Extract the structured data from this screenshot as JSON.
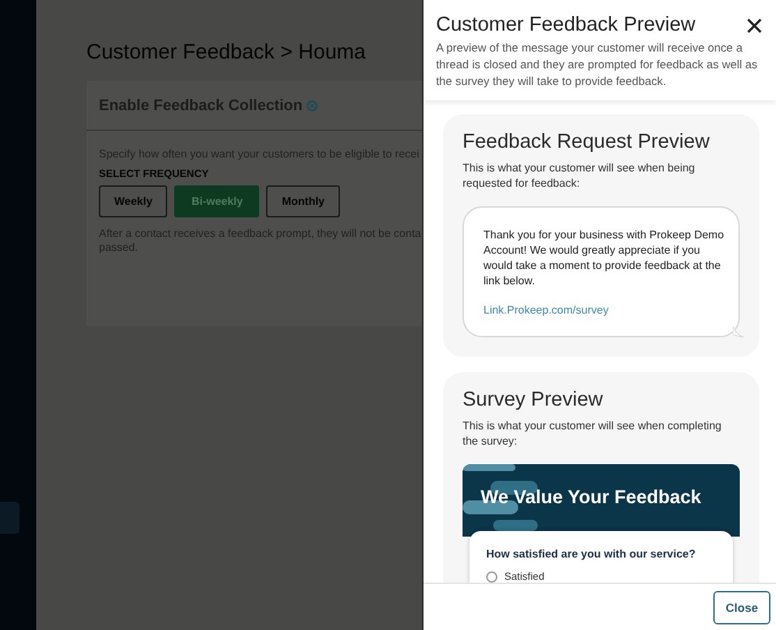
{
  "background": {
    "title": "Customer Feedback > Houma",
    "card": {
      "title": "Enable Feedback Collection",
      "description": "Specify how often you want your customers to be eligible to recei",
      "frequency_label": "SELECT FREQUENCY",
      "frequencies": [
        {
          "label": "Weekly",
          "selected": false
        },
        {
          "label": "Bi-weekly",
          "selected": true
        },
        {
          "label": "Monthly",
          "selected": false
        }
      ],
      "note_lines": [
        "After a contact receives a feedback prompt, they will not be conta",
        "passed."
      ]
    }
  },
  "panel": {
    "title": "Customer Feedback Preview",
    "description": "A preview of the message your customer will receive once a thread is closed and they are prompted for feedback as well as the survey they will take to provide feedback.",
    "sections": [
      {
        "kind": "message",
        "title": "Feedback Request Preview",
        "description": "This is what your customer will see when being requested for feedback:",
        "message": "Thank you for your business with Prokeep Demo Account! We would greatly appreciate if you would take a moment to provide feedback at the link below.",
        "link": "Link.Prokeep.com/survey"
      },
      {
        "kind": "survey",
        "title": "Survey Preview",
        "description": "This is what your customer will see when completing the survey:",
        "banner_title": "We Value Your Feedback",
        "question": "How satisfied are you with our service?",
        "options": [
          {
            "label": "Satisfied",
            "selected": false
          }
        ]
      }
    ],
    "footer_button": "Close"
  }
}
